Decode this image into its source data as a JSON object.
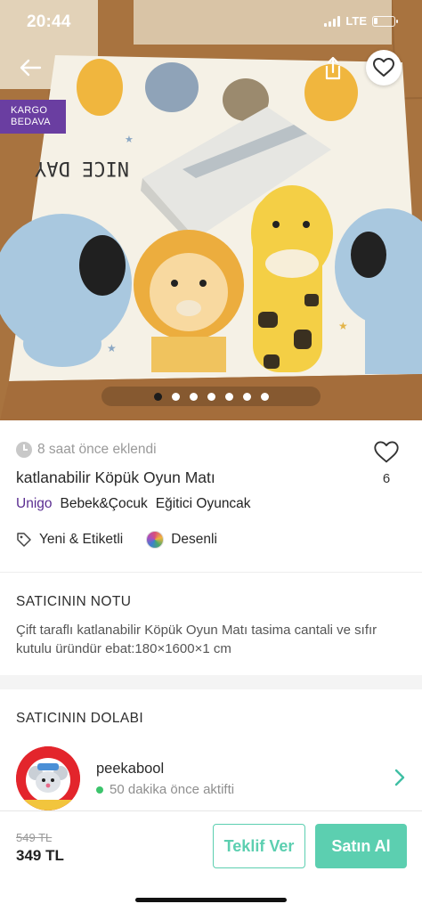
{
  "status_bar": {
    "time": "20:44",
    "carrier": "LTE"
  },
  "hero": {
    "badge_line1": "KARGO",
    "badge_line2": "BEDAVA",
    "mat_print": "NICE DAY",
    "image_count": 7,
    "active_image_index": 0
  },
  "product": {
    "added": "8 saat önce eklendi",
    "title": "katlanabilir Köpük Oyun Matı",
    "likes": "6",
    "brand": "Unigo",
    "categories": [
      "Bebek&Çocuk",
      "Eğitici Oyuncak"
    ],
    "condition": "Yeni & Etiketli",
    "pattern": "Desenli"
  },
  "seller_note": {
    "heading": "SATICININ NOTU",
    "text": "Çift taraflı katlanabilir Köpük Oyun Matı tasima cantali ve sıfır kutulu üründür ebat:180×1600×1 cm"
  },
  "seller_closet": {
    "heading": "SATICININ DOLABI",
    "name": "peekabool",
    "status": "50 dakika önce aktifti",
    "avatar_text": "peekabool"
  },
  "bottom_bar": {
    "old_price": "549 TL",
    "price": "349 TL",
    "offer_label": "Teklif Ver",
    "buy_label": "Satın Al"
  },
  "colors": {
    "accent": "#5ccfb0",
    "brand_purple": "#5a2d91",
    "badge_purple": "#6a3ea1",
    "online_green": "#3cc46c"
  },
  "icons": {
    "back": "back-arrow-icon",
    "share": "share-icon",
    "favorite": "heart-icon",
    "time": "clock-icon",
    "tag": "tag-icon",
    "pattern": "pattern-swatch-icon",
    "chevron": "chevron-right-icon"
  }
}
